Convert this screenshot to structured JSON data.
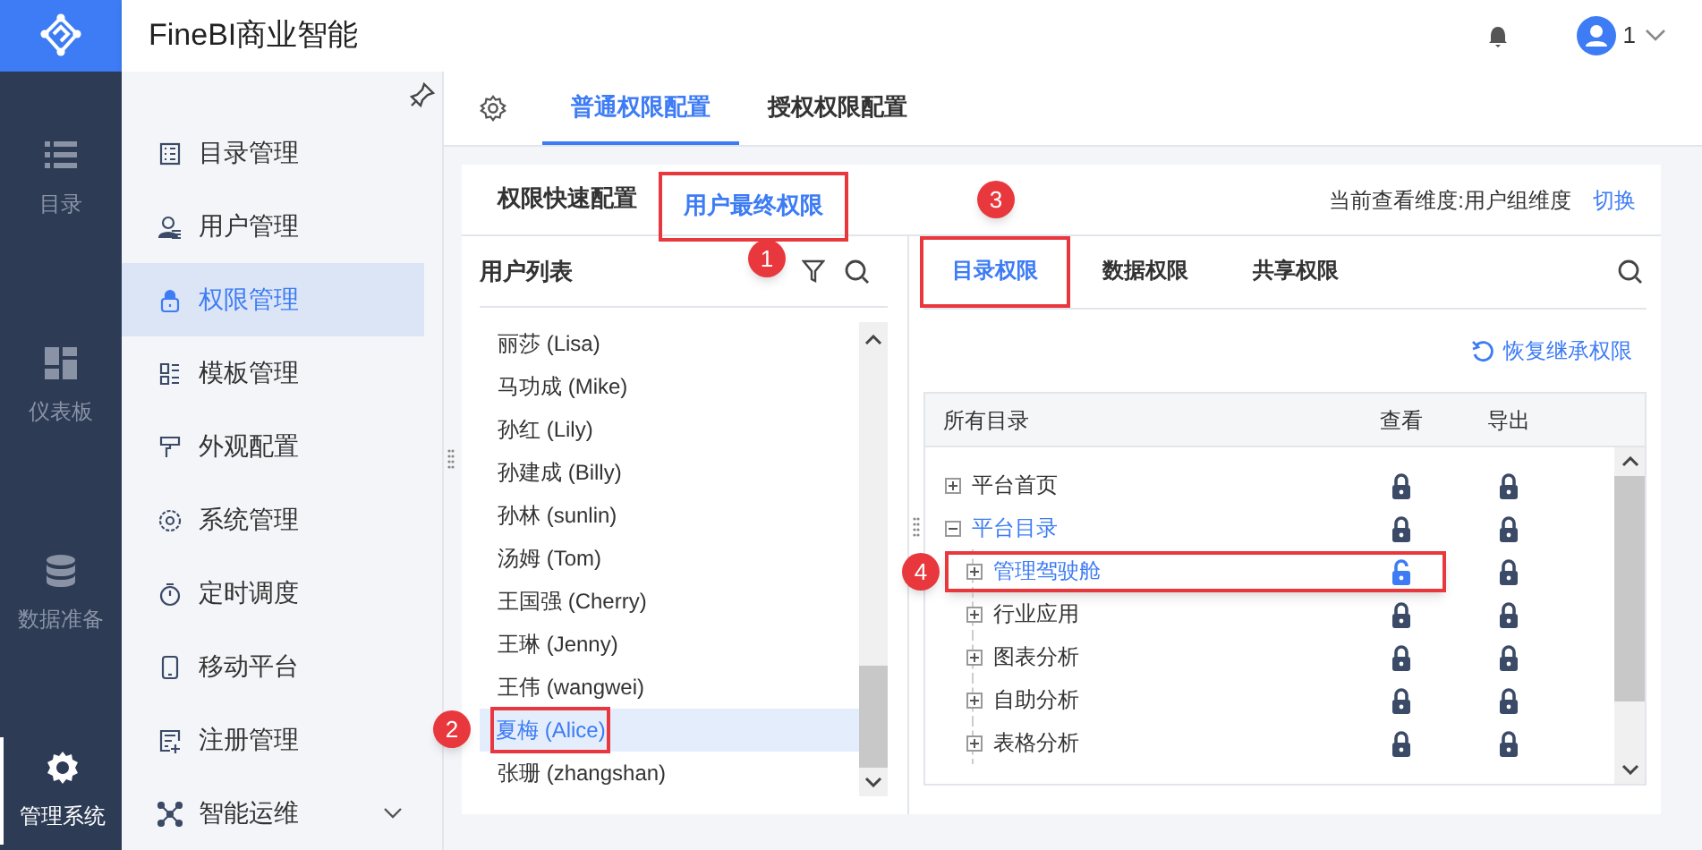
{
  "app": {
    "title": "FineBI商业智能",
    "user": "1"
  },
  "rail": [
    {
      "label": "目录",
      "selected": false
    },
    {
      "label": "仪表板",
      "selected": false
    },
    {
      "label": "数据准备",
      "selected": false
    },
    {
      "label": "管理系统",
      "selected": true
    }
  ],
  "menu": [
    {
      "label": "目录管理",
      "selected": false
    },
    {
      "label": "用户管理",
      "selected": false
    },
    {
      "label": "权限管理",
      "selected": true
    },
    {
      "label": "模板管理",
      "selected": false
    },
    {
      "label": "外观配置",
      "selected": false
    },
    {
      "label": "系统管理",
      "selected": false
    },
    {
      "label": "定时调度",
      "selected": false
    },
    {
      "label": "移动平台",
      "selected": false
    },
    {
      "label": "注册管理",
      "selected": false
    },
    {
      "label": "智能运维",
      "selected": false,
      "expandable": true
    }
  ],
  "top_tabs": [
    {
      "label": "普通权限配置",
      "selected": true
    },
    {
      "label": "授权权限配置",
      "selected": false
    }
  ],
  "sub_tabs": [
    {
      "label": "权限快速配置",
      "selected": false
    },
    {
      "label": "用户最终权限",
      "selected": true,
      "callout": "1"
    }
  ],
  "dimension": {
    "text": "当前查看维度:用户组维度",
    "link": "切换"
  },
  "user_list": {
    "title": "用户列表",
    "users": [
      {
        "name": "丽莎 (Lisa)",
        "selected": false
      },
      {
        "name": "马功成 (Mike)",
        "selected": false
      },
      {
        "name": "孙红 (Lily)",
        "selected": false
      },
      {
        "name": "孙建成 (Billy)",
        "selected": false
      },
      {
        "name": "孙林 (sunlin)",
        "selected": false
      },
      {
        "name": "汤姆 (Tom)",
        "selected": false
      },
      {
        "name": "王国强 (Cherry)",
        "selected": false
      },
      {
        "name": "王琳 (Jenny)",
        "selected": false
      },
      {
        "name": "王伟 (wangwei)",
        "selected": false
      },
      {
        "name": "夏梅 (Alice)",
        "selected": true,
        "callout": "2"
      },
      {
        "name": "张珊 (zhangshan)",
        "selected": false
      }
    ]
  },
  "perm_tabs": [
    {
      "label": "目录权限",
      "selected": true,
      "callout": "3"
    },
    {
      "label": "数据权限",
      "selected": false
    },
    {
      "label": "共享权限",
      "selected": false
    }
  ],
  "restore_link": "恢复继承权限",
  "table": {
    "columns": [
      "所有目录",
      "查看",
      "导出"
    ],
    "rows": [
      {
        "name": "平台首页",
        "expanded": false,
        "selected": false,
        "view_locked": true,
        "export_locked": true
      },
      {
        "name": "平台目录",
        "expanded": true,
        "selected": true,
        "view_locked": true,
        "export_locked": true,
        "children": [
          {
            "name": "管理驾驶舱",
            "expanded": false,
            "selected": true,
            "view_locked": false,
            "export_locked": true,
            "callout": "4"
          },
          {
            "name": "行业应用",
            "expanded": false,
            "selected": false,
            "view_locked": true,
            "export_locked": true
          },
          {
            "name": "图表分析",
            "expanded": false,
            "selected": false,
            "view_locked": true,
            "export_locked": true
          },
          {
            "name": "自助分析",
            "expanded": false,
            "selected": false,
            "view_locked": true,
            "export_locked": true
          },
          {
            "name": "表格分析",
            "expanded": false,
            "selected": false,
            "view_locked": true,
            "export_locked": true
          }
        ]
      }
    ]
  }
}
